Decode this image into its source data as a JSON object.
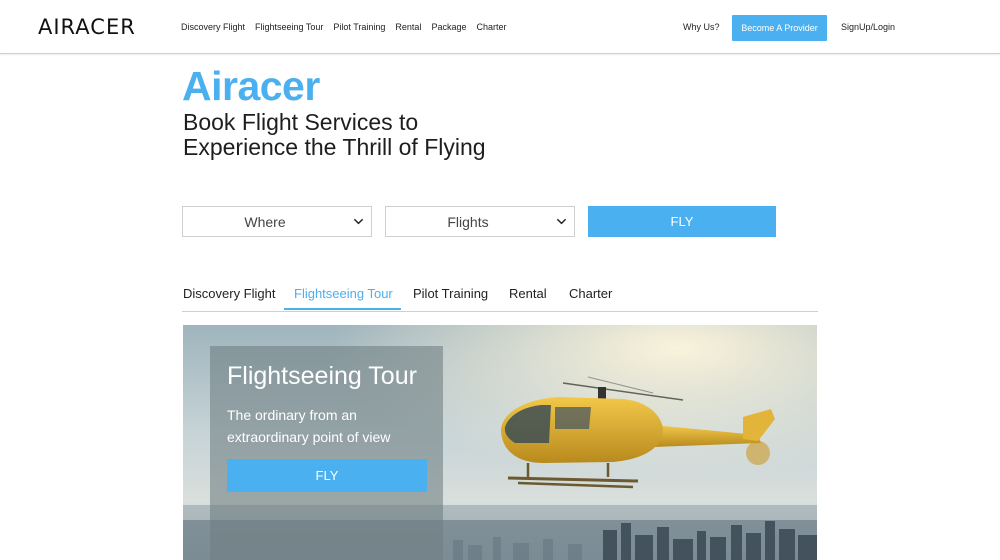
{
  "header": {
    "logo": "AIRACER",
    "nav": [
      "Discovery Flight",
      "Flightseeing Tour",
      "Pilot Training",
      "Rental",
      "Package",
      "Charter"
    ],
    "why_us": "Why Us?",
    "provider_button": "Become A Provider",
    "signup": "SignUp/Login"
  },
  "hero": {
    "brand": "Airacer",
    "tagline_line1": "Book Flight Services to",
    "tagline_line2": "Experience the Thrill of Flying"
  },
  "search": {
    "where": "Where",
    "flights": "Flights",
    "fly": "FLY"
  },
  "tabs": {
    "items": [
      "Discovery Flight",
      "Flightseeing Tour",
      "Pilot Training",
      "Rental",
      "Charter"
    ],
    "active": "Flightseeing Tour"
  },
  "banner": {
    "title": "Flightseeing Tour",
    "subtitle": "The ordinary from an extraordinary point of view",
    "button": "FLY"
  },
  "icons": {
    "dropdown": "chevron-down-icon"
  },
  "colors": {
    "accent": "#4bb0f0",
    "text": "#1e1e1e",
    "border": "#cfcfcf"
  }
}
